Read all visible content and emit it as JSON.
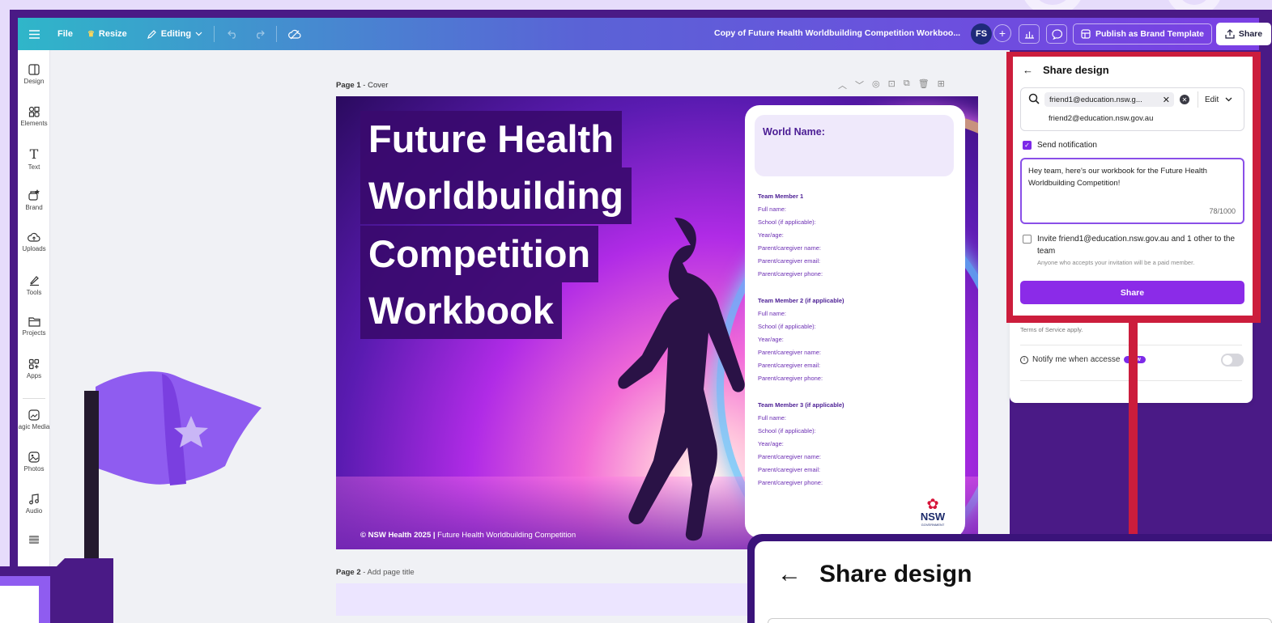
{
  "topbar": {
    "file": "File",
    "resize": "Resize",
    "editing": "Editing",
    "doc_title": "Copy of Future Health Worldbuilding Competition Workboo...",
    "avatar": "FS",
    "publish": "Publish as Brand Template",
    "share": "Share"
  },
  "sidebar": {
    "items": [
      {
        "label": "Design",
        "icon": "design-icon"
      },
      {
        "label": "Elements",
        "icon": "elements-icon"
      },
      {
        "label": "Text",
        "icon": "text-icon"
      },
      {
        "label": "Brand",
        "icon": "brand-icon"
      },
      {
        "label": "Uploads",
        "icon": "uploads-icon"
      },
      {
        "label": "Tools",
        "icon": "tools-icon"
      },
      {
        "label": "Projects",
        "icon": "projects-icon"
      },
      {
        "label": "Apps",
        "icon": "apps-icon"
      },
      {
        "label": "agic Media",
        "icon": "magic-media-icon"
      },
      {
        "label": "Photos",
        "icon": "photos-icon"
      },
      {
        "label": "Audio",
        "icon": "audio-icon"
      }
    ]
  },
  "canvas": {
    "page1_label": "Page 1",
    "page1_title": " - Cover",
    "page2_label": "Page 2",
    "page2_title": " - Add page title",
    "cover_title": [
      "Future Health",
      "Worldbuilding",
      "Competition",
      "Workbook"
    ],
    "footer_bold": "© NSW Health 2025 |",
    "footer_rest": " Future Health Worldbuilding Competition",
    "world_name": "World Name:",
    "teams": [
      {
        "heading": "Team Member 1",
        "fields": [
          "Full name:",
          "School (if applicable):",
          "Year/age:",
          "Parent/caregiver name:",
          "Parent/caregiver email:",
          "Parent/caregiver phone:"
        ]
      },
      {
        "heading": "Team Member 2 (if applicable)",
        "fields": [
          "Full name:",
          "School (if applicable):",
          "Year/age:",
          "Parent/caregiver name:",
          "Parent/caregiver email:",
          "Parent/caregiver phone:"
        ]
      },
      {
        "heading": "Team Member 3 (if applicable)",
        "fields": [
          "Full name:",
          "School (if applicable):",
          "Year/age:",
          "Parent/caregiver name:",
          "Parent/caregiver email:",
          "Parent/caregiver phone:"
        ]
      }
    ],
    "nsw_logo_text": "NSW",
    "nsw_sub": "GOVERNMENT"
  },
  "share_panel": {
    "title": "Share design",
    "email_chip": "friend1@education.nsw.g...",
    "email_2": "friend2@education.nsw.gov.au",
    "permission": "Edit",
    "send_notification": "Send notification",
    "message": "Hey team, here's our workbook for the Future Health Worldbuilding Competition!",
    "char_count": "78/1000",
    "invite_text": "Invite friend1@education.nsw.gov.au and 1 other to the team",
    "invite_sub": "Anyone who accepts your invitation will be a paid member.",
    "share_button": "Share"
  },
  "background_panel": {
    "terms": "Terms of Service apply.",
    "notify": "Notify me when accesse",
    "new_badge": "New"
  },
  "zoom_callout": {
    "title": "Share design"
  },
  "colors": {
    "accent": "#7d2ae8",
    "highlight": "#cc1d3c",
    "frame": "#4a1a86"
  }
}
